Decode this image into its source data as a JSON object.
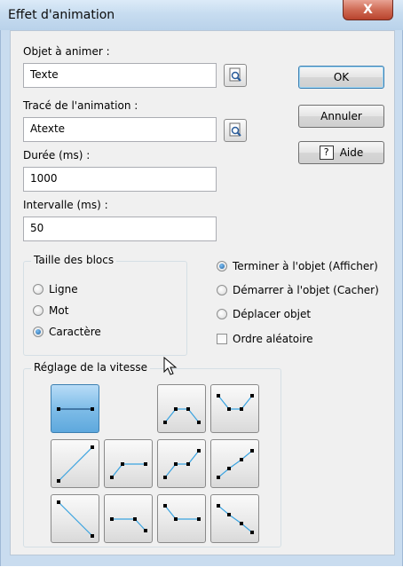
{
  "window": {
    "title": "Effet d'animation",
    "close_label": "X"
  },
  "objet": {
    "label": "Objet à animer :",
    "value": "Texte"
  },
  "trace": {
    "label": "Tracé de l'animation :",
    "value": "Atexte"
  },
  "duree": {
    "label": "Durée (ms) :",
    "value": "1000"
  },
  "intervalle": {
    "label": "Intervalle (ms) :",
    "value": "50"
  },
  "buttons": {
    "ok": "OK",
    "annuler": "Annuler",
    "aide": "Aide",
    "aide_icon_text": "?"
  },
  "taille_blocs": {
    "title": "Taille des blocs",
    "options": [
      "Ligne",
      "Mot",
      "Caractère"
    ],
    "selected": "Caractère"
  },
  "mode": {
    "options": [
      "Terminer à l'objet (Afficher)",
      "Démarrer à l'objet (Cacher)",
      "Déplacer objet"
    ],
    "selected": "Terminer à l'objet (Afficher)"
  },
  "ordre_aleatoire": {
    "label": "Ordre aléatoire",
    "checked": false
  },
  "vitesse": {
    "title": "Réglage de la vitesse",
    "selected_index": 0
  },
  "colors": {
    "accent": "#3c7fb1",
    "selected_tile": "#7fbde8"
  }
}
